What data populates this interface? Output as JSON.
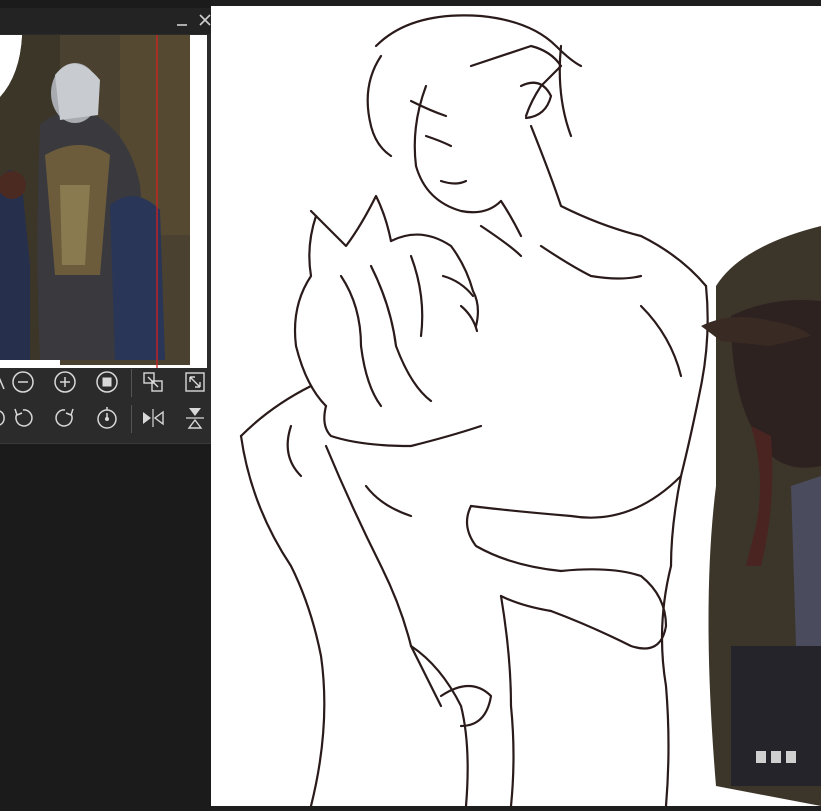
{
  "window": {
    "minimize_glyph": "—",
    "close_glyph": "✕"
  },
  "navigator": {
    "toolbar_row_1": [
      {
        "icon": "flip-icon-partial"
      },
      {
        "icon": "zoom-out-icon"
      },
      {
        "icon": "zoom-in-icon"
      },
      {
        "icon": "actual-size-icon"
      },
      {
        "icon": "fit-window-icon"
      },
      {
        "icon": "fill-window-icon"
      }
    ],
    "toolbar_row_2": [
      {
        "icon": "rotate-partial-icon"
      },
      {
        "icon": "rotate-left-icon"
      },
      {
        "icon": "rotate-right-icon"
      },
      {
        "icon": "reset-rotation-icon"
      },
      {
        "icon": "flip-horizontal-icon"
      },
      {
        "icon": "flip-vertical-icon"
      }
    ]
  },
  "colors": {
    "panel_bg": "#2b2b2b",
    "app_bg": "#1b1b1b",
    "canvas_bg": "#ffffff",
    "ink": "#2a1a1a",
    "view_frame": "#d42020"
  }
}
